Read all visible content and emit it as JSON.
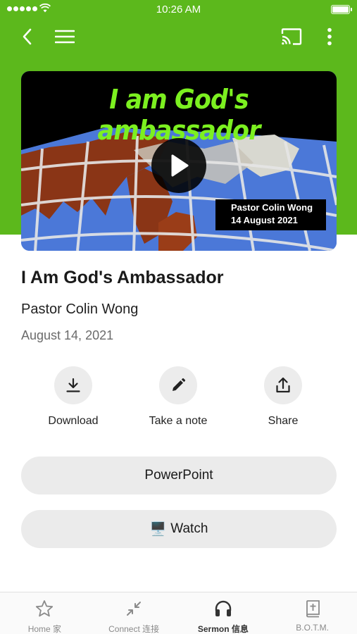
{
  "status_bar": {
    "time": "10:26 AM"
  },
  "thumbnail": {
    "title_text": "I am God's ambassador",
    "caption_line1": "Pastor Colin Wong",
    "caption_line2": "14 August 2021"
  },
  "sermon": {
    "title": "I Am God's Ambassador",
    "speaker": "Pastor Colin Wong",
    "date": "August 14, 2021"
  },
  "actions": [
    {
      "label": "Download",
      "icon": "download-icon"
    },
    {
      "label": "Take a note",
      "icon": "pencil-icon"
    },
    {
      "label": "Share",
      "icon": "share-icon"
    }
  ],
  "buttons": {
    "powerpoint": "PowerPoint",
    "watch": "Watch",
    "watch_glyph": "🖥️"
  },
  "tabs": [
    {
      "label": "Home 家",
      "icon": "star-icon",
      "active": false
    },
    {
      "label": "Connect 连接",
      "icon": "connect-icon",
      "active": false
    },
    {
      "label": "Sermon 信息",
      "icon": "headphones-icon",
      "active": true
    },
    {
      "label": "B.O.T.M.",
      "icon": "bible-icon",
      "active": false
    }
  ],
  "colors": {
    "header": "#5cb81c",
    "thumbnail_title": "#7cf020",
    "button_bg": "#ebebeb"
  }
}
